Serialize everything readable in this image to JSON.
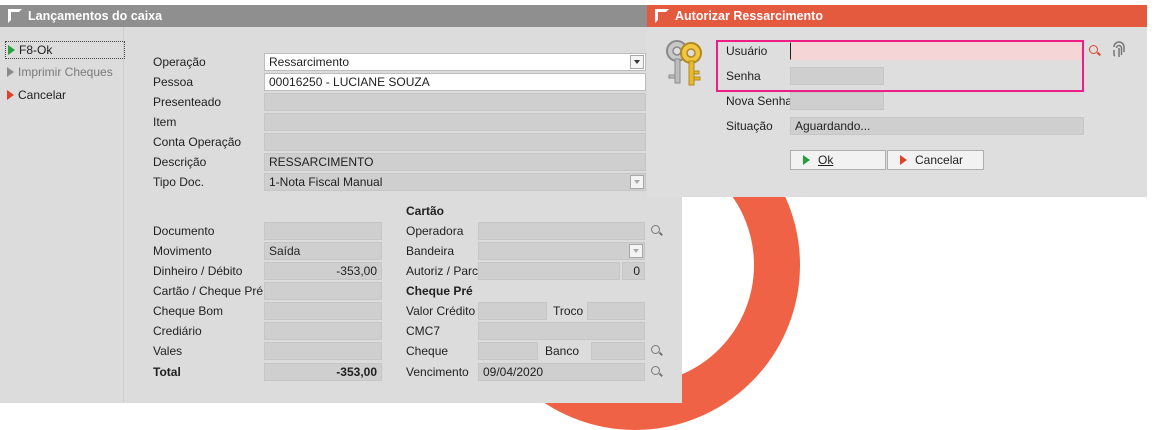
{
  "colors": {
    "accent": "#e35a3f",
    "titlebar_gray": "#8f8f8f",
    "highlight": "#ef1e87"
  },
  "main_window": {
    "title": "Lançamentos do caixa",
    "sidebar": {
      "f8_ok": {
        "label": "F8-Ok",
        "icon": "play-green-icon"
      },
      "print_cheques": {
        "label": "Imprimir Cheques",
        "icon": "play-gray-icon"
      },
      "cancel": {
        "label": "Cancelar",
        "icon": "play-red-icon"
      }
    },
    "form": {
      "operacao": {
        "label": "Operação",
        "value": "Ressarcimento"
      },
      "pessoa": {
        "label": "Pessoa",
        "value": "00016250 - LUCIANE SOUZA"
      },
      "presenteado": {
        "label": "Presenteado",
        "value": ""
      },
      "item": {
        "label": "Item",
        "value": ""
      },
      "conta_operacao": {
        "label": "Conta Operação",
        "value": ""
      },
      "descricao": {
        "label": "Descrição",
        "value": "RESSARCIMENTO"
      },
      "tipo_doc": {
        "label": "Tipo Doc.",
        "value": "1-Nota Fiscal Manual"
      }
    },
    "values": {
      "documento": {
        "label": "Documento",
        "value": ""
      },
      "movimento": {
        "label": "Movimento",
        "value": "Saída"
      },
      "dinheiro_debito": {
        "label": "Dinheiro / Débito",
        "value": "-353,00"
      },
      "cartao_cheque_pre": {
        "label": "Cartão / Cheque Pré",
        "value": ""
      },
      "cheque_bom": {
        "label": "Cheque Bom",
        "value": ""
      },
      "crediario": {
        "label": "Crediário",
        "value": ""
      },
      "vales": {
        "label": "Vales",
        "value": ""
      },
      "total": {
        "label": "Total",
        "value": "-353,00"
      }
    },
    "cartao": {
      "heading": "Cartão",
      "operadora": {
        "label": "Operadora",
        "value": ""
      },
      "bandeira": {
        "label": "Bandeira",
        "value": ""
      },
      "autoriz_parc": {
        "label": "Autoriz / Parc",
        "value": "",
        "parc": "0"
      }
    },
    "cheque_pre": {
      "heading": "Cheque Pré",
      "valor_credito": {
        "label": "Valor Crédito",
        "value": ""
      },
      "troco": {
        "label": "Troco",
        "value": ""
      },
      "cmc7": {
        "label": "CMC7",
        "value": ""
      },
      "cheque": {
        "label": "Cheque",
        "value": ""
      },
      "banco": {
        "label": "Banco",
        "value": ""
      },
      "vencimento": {
        "label": "Vencimento",
        "value": "09/04/2020"
      }
    }
  },
  "auth_dialog": {
    "title": "Autorizar Ressarcimento",
    "usuario": {
      "label": "Usuário",
      "value": ""
    },
    "senha": {
      "label": "Senha",
      "value": ""
    },
    "nova_senha": {
      "label": "Nova Senha",
      "value": ""
    },
    "situacao": {
      "label": "Situação",
      "value": "Aguardando..."
    },
    "ok_button": {
      "label": "Ok"
    },
    "cancel_button": {
      "label": "Cancelar"
    }
  }
}
